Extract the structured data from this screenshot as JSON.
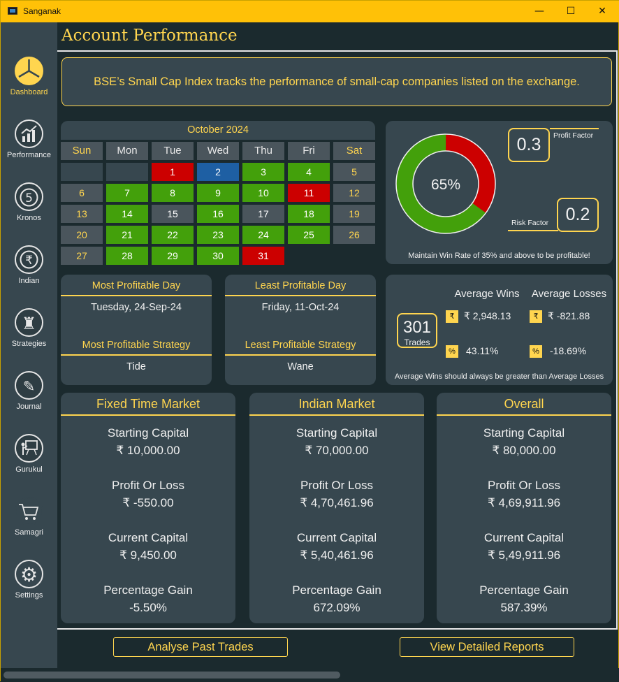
{
  "window": {
    "title": "Sanganak",
    "minimize_glyph": "—",
    "maximize_glyph": "☐",
    "close_glyph": "✕"
  },
  "sidebar": {
    "items": [
      {
        "label": "Dashboard",
        "icon": "dashboard-pie-icon",
        "active": true
      },
      {
        "label": "Performance",
        "icon": "performance-chart-icon"
      },
      {
        "label": "Kronos",
        "icon": "kronos-clock-icon",
        "glyph": "5"
      },
      {
        "label": "Indian",
        "icon": "rupee-icon",
        "glyph": "₹"
      },
      {
        "label": "Strategies",
        "icon": "chess-piece-icon",
        "glyph": "♜"
      },
      {
        "label": "Journal",
        "icon": "quill-icon",
        "glyph": "✎"
      },
      {
        "label": "Gurukul",
        "icon": "teacher-board-icon"
      },
      {
        "label": "Samagri",
        "icon": "shopping-cart-icon"
      },
      {
        "label": "Settings",
        "icon": "gear-icon",
        "glyph": "⚙"
      }
    ]
  },
  "page": {
    "title": "Account Performance",
    "banner": "BSE’s Small Cap Index tracks the performance of small-cap companies listed on the exchange."
  },
  "calendar": {
    "month": "October 2024",
    "days": [
      "Sun",
      "Mon",
      "Tue",
      "Wed",
      "Thu",
      "Fri",
      "Sat"
    ],
    "weeks": [
      [
        {
          "d": "",
          "s": "empty"
        },
        {
          "d": "",
          "s": "empty"
        },
        {
          "d": "1",
          "s": "loss"
        },
        {
          "d": "2",
          "s": "neutral-blue"
        },
        {
          "d": "3",
          "s": "profit"
        },
        {
          "d": "4",
          "s": "profit"
        },
        {
          "d": "5",
          "s": "weekend"
        }
      ],
      [
        {
          "d": "6",
          "s": "weekend"
        },
        {
          "d": "7",
          "s": "profit"
        },
        {
          "d": "8",
          "s": "profit"
        },
        {
          "d": "9",
          "s": "profit"
        },
        {
          "d": "10",
          "s": "profit"
        },
        {
          "d": "11",
          "s": "loss"
        },
        {
          "d": "12",
          "s": "weekend"
        }
      ],
      [
        {
          "d": "13",
          "s": "weekend"
        },
        {
          "d": "14",
          "s": "profit"
        },
        {
          "d": "15",
          "s": "none"
        },
        {
          "d": "16",
          "s": "profit"
        },
        {
          "d": "17",
          "s": "none"
        },
        {
          "d": "18",
          "s": "profit"
        },
        {
          "d": "19",
          "s": "weekend"
        }
      ],
      [
        {
          "d": "20",
          "s": "weekend"
        },
        {
          "d": "21",
          "s": "profit"
        },
        {
          "d": "22",
          "s": "profit"
        },
        {
          "d": "23",
          "s": "profit"
        },
        {
          "d": "24",
          "s": "profit"
        },
        {
          "d": "25",
          "s": "profit"
        },
        {
          "d": "26",
          "s": "weekend"
        }
      ],
      [
        {
          "d": "27",
          "s": "weekend"
        },
        {
          "d": "28",
          "s": "profit"
        },
        {
          "d": "29",
          "s": "profit"
        },
        {
          "d": "30",
          "s": "profit"
        },
        {
          "d": "31",
          "s": "loss"
        }
      ]
    ]
  },
  "winrate": {
    "value_text": "65%",
    "win_fraction": 0.65,
    "win_color": "#43a00b",
    "loss_color": "#cc0000",
    "profit_factor_label": "Profit Factor",
    "profit_factor": "0.3",
    "risk_factor_label": "Risk Factor",
    "risk_factor": "0.2",
    "note": "Maintain Win Rate of 35% and above to be profitable!"
  },
  "most_profitable": {
    "day_title": "Most Profitable Day",
    "day": "Tuesday, 24-Sep-24",
    "strategy_title": "Most Profitable Strategy",
    "strategy": "Tide"
  },
  "least_profitable": {
    "day_title": "Least Profitable Day",
    "day": "Friday, 11-Oct-24",
    "strategy_title": "Least Profitable Strategy",
    "strategy": "Wane"
  },
  "averages": {
    "trades_count": "301",
    "trades_label": "Trades",
    "wins_title": "Average Wins",
    "losses_title": "Average Losses",
    "rupee_badge": "₹",
    "percent_badge": "%",
    "wins_amount": "₹ 2,948.13",
    "losses_amount": "₹ -821.88",
    "wins_percent": "43.11%",
    "losses_percent": "-18.69%",
    "note": "Average Wins should always be greater than Average Losses"
  },
  "markets": [
    {
      "title": "Fixed Time Market",
      "starting_label": "Starting Capital",
      "starting": "₹ 10,000.00",
      "pl_label": "Profit Or Loss",
      "pl": "₹ -550.00",
      "current_label": "Current Capital",
      "current": "₹ 9,450.00",
      "gain_label": "Percentage Gain",
      "gain": "-5.50%"
    },
    {
      "title": "Indian Market",
      "starting_label": "Starting Capital",
      "starting": "₹ 70,000.00",
      "pl_label": "Profit Or Loss",
      "pl": "₹ 4,70,461.96",
      "current_label": "Current Capital",
      "current": "₹ 5,40,461.96",
      "gain_label": "Percentage Gain",
      "gain": "672.09%"
    },
    {
      "title": "Overall",
      "starting_label": "Starting Capital",
      "starting": "₹ 80,000.00",
      "pl_label": "Profit Or Loss",
      "pl": "₹ 4,69,911.96",
      "current_label": "Current Capital",
      "current": "₹ 5,49,911.96",
      "gain_label": "Percentage Gain",
      "gain": "587.39%"
    }
  ],
  "actions": {
    "analyse": "Analyse Past Trades",
    "reports": "View Detailed Reports"
  }
}
